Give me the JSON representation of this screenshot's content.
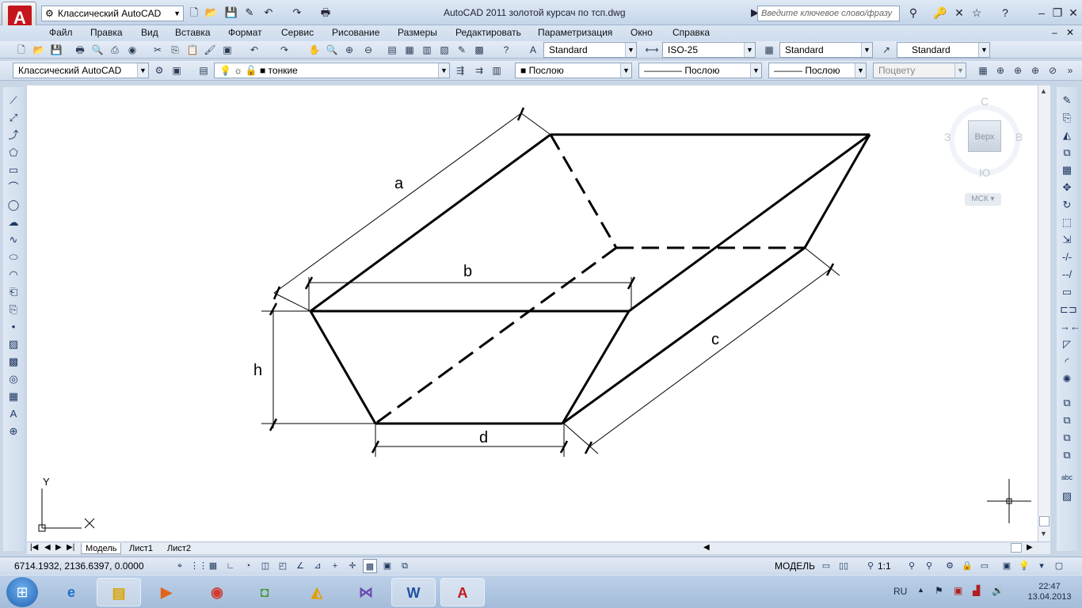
{
  "app": {
    "title": "AutoCAD 2011     золотой курсач по тсп.dwg",
    "workspace": "Классический AutoCAD",
    "search_placeholder": "Введите ключевое слово/фразу"
  },
  "menu": [
    "Файл",
    "Правка",
    "Вид",
    "Вставка",
    "Формат",
    "Сервис",
    "Рисование",
    "Размеры",
    "Редактировать",
    "Параметризация",
    "Окно",
    "Справка"
  ],
  "styles_toolbar": {
    "text_style": "Standard",
    "dim_style": "ISO-25",
    "table_style": "Standard",
    "mleader_style": "Standard"
  },
  "layers_toolbar": {
    "workspace": "Классический AutoCAD",
    "layer": "тонкие",
    "color": "Послою",
    "linetype": "Послою",
    "lineweight": "Послою",
    "plotstyle": "Поцвету"
  },
  "drawing": {
    "labels": {
      "a": "a",
      "b": "b",
      "c": "c",
      "d": "d",
      "h": "h"
    },
    "ucs_x": "X",
    "ucs_y": "Y"
  },
  "viewcube": {
    "top": "Верх",
    "north": "С",
    "south": "Ю",
    "east": "В",
    "west": "З",
    "ucs": "МСК"
  },
  "tabs": [
    "Модель",
    "Лист1",
    "Лист2"
  ],
  "status": {
    "coords": "6714.1932, 2136.6397, 0.0000",
    "model": "МОДЕЛЬ",
    "scale": "1:1"
  },
  "taskbar": {
    "lang": "RU",
    "time": "22:47",
    "date": "13.04.2013"
  },
  "colors": {
    "autocad_red": "#c4161c",
    "canvas": "#ffffff",
    "chrome": "#d2deed"
  }
}
